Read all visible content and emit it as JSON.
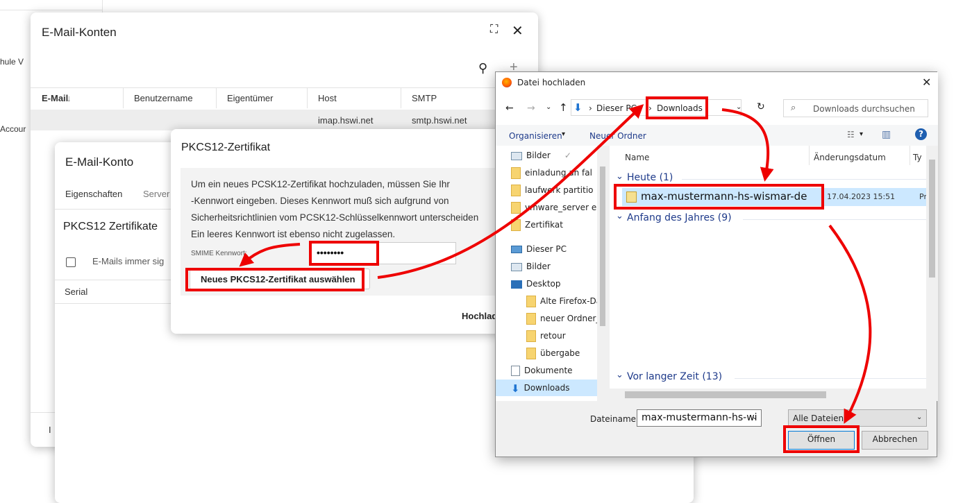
{
  "bg_sidebar": {
    "items": [
      "hule V",
      "Accour"
    ]
  },
  "accounts_window": {
    "title": "E-Mail-Konten",
    "columns": [
      "E-Mail",
      "Benutzername",
      "Eigentümer",
      "Host",
      "SMTP"
    ],
    "sort_mark": "↓",
    "row": {
      "host": "imap.hswi.net",
      "smtp": "smtp.hswi.net"
    },
    "footer_label": "I"
  },
  "account_window": {
    "title": "E-Mail-Konto",
    "tabs": [
      "Eigenschaften",
      "Server"
    ],
    "section_title": "PKCS12 Zertifikate",
    "checkbox_label": "E-Mails immer sig",
    "col_serial": "Serial"
  },
  "pkcs_dialog": {
    "title": "PKCS12-Zertifikat",
    "info_lines": [
      "Um ein neues PCSK12-Zertifikat hochzuladen, müssen Sie Ihr",
      "-Kennwort eingeben. Dieses Kennwort muß sich aufgrund von",
      "Sicherheitsrichtlinien vom PCSK12-Schlüsselkennwort unterscheiden",
      "Ein leeres Kennwort ist ebenso nicht zugelassen."
    ],
    "password_label": "SMIME Kennwort:",
    "password_value": "••••••••",
    "select_button": "Neues PKCS12-Zertifikat auswählen",
    "upload_button": "Hochlad"
  },
  "file_dialog": {
    "title": "Datei hochladen",
    "breadcrumb": [
      "Dieser PC",
      "Downloads"
    ],
    "search_placeholder": "Downloads durchsuchen",
    "toolbar": {
      "organize": "Organisieren",
      "new_folder": "Neuer Ordner"
    },
    "tree": [
      {
        "label": "Bilder",
        "icon": "pictures-icon"
      },
      {
        "label": "einladung an fal",
        "icon": "folder-icon"
      },
      {
        "label": "laufwerk partitio",
        "icon": "folder-icon"
      },
      {
        "label": "vmware_server e",
        "icon": "folder-icon"
      },
      {
        "label": "Zertifikat",
        "icon": "folder-icon"
      },
      {
        "label": "Dieser PC",
        "icon": "pc-icon"
      },
      {
        "label": "Bilder",
        "icon": "pictures-icon"
      },
      {
        "label": "Desktop",
        "icon": "desktop-icon"
      },
      {
        "label": "Alte Firefox-Da",
        "icon": "folder-icon"
      },
      {
        "label": "neuer Ordner_",
        "icon": "folder-icon"
      },
      {
        "label": "retour",
        "icon": "folder-icon"
      },
      {
        "label": "übergabe",
        "icon": "folder-icon"
      },
      {
        "label": "Dokumente",
        "icon": "documents-icon"
      },
      {
        "label": "Downloads",
        "icon": "download-icon"
      }
    ],
    "columns": {
      "name": "Name",
      "date": "Änderungsdatum",
      "type": "Ty"
    },
    "groups": [
      "Heute (1)",
      "Anfang des Jahres (9)",
      "Vor langer Zeit (13)"
    ],
    "file": {
      "name": "max-mustermann-hs-wismar-de",
      "date": "17.04.2023 15:51",
      "type": "Pr"
    },
    "filename_label": "Dateiname:",
    "filename_value": "max-mustermann-hs-wi",
    "filetype": "Alle Dateien",
    "open_button": "Öffnen",
    "cancel_button": "Abbrechen"
  },
  "colors": {
    "highlight": "#ee0000",
    "selection": "#cce8ff",
    "link_blue": "#1e3a8a"
  }
}
